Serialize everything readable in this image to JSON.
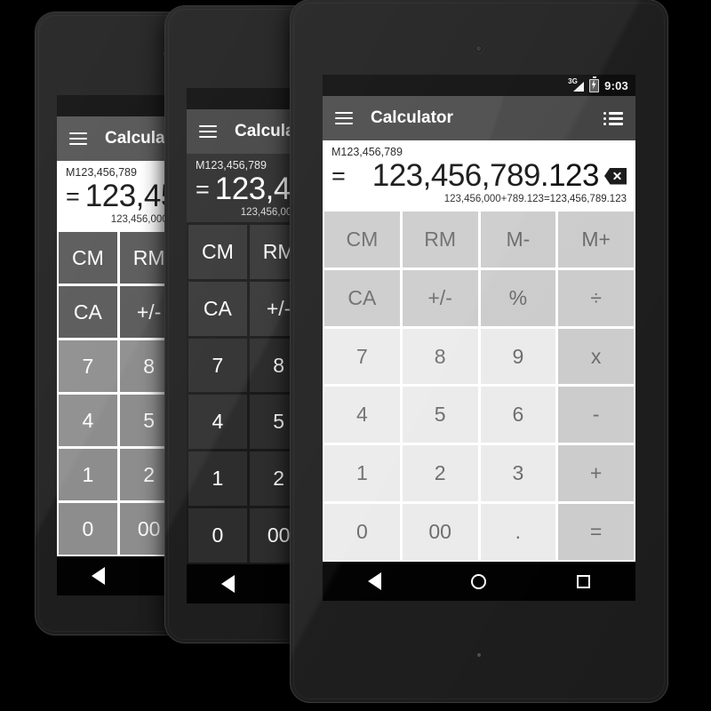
{
  "scene": {
    "background": "#000000",
    "device_count": 3,
    "description": "Three Android tablets showing a Calculator app in three color themes"
  },
  "status_bar": {
    "network_label": "3G",
    "network_icon": "signal-3g-icon",
    "battery_icon": "battery-charging-icon",
    "time": "9:03"
  },
  "app_bar": {
    "menu_icon": "hamburger-menu-icon",
    "title": "Calculator",
    "history_icon": "history-list-icon"
  },
  "display": {
    "memory_indicator": "M123,456,789",
    "equals_prefix": "=",
    "value": "123,456,789.123",
    "backspace_icon": "backspace-icon",
    "formula": "123,456,000+789.123=123,456,789.123"
  },
  "keypad": {
    "rows": [
      [
        {
          "label": "CM",
          "type": "func"
        },
        {
          "label": "RM",
          "type": "func"
        },
        {
          "label": "M-",
          "type": "func"
        },
        {
          "label": "M+",
          "type": "func"
        }
      ],
      [
        {
          "label": "CA",
          "type": "func"
        },
        {
          "label": "+/-",
          "type": "func"
        },
        {
          "label": "%",
          "type": "func"
        },
        {
          "label": "÷",
          "type": "op"
        }
      ],
      [
        {
          "label": "7",
          "type": "digit"
        },
        {
          "label": "8",
          "type": "digit"
        },
        {
          "label": "9",
          "type": "digit"
        },
        {
          "label": "x",
          "type": "op"
        }
      ],
      [
        {
          "label": "4",
          "type": "digit"
        },
        {
          "label": "5",
          "type": "digit"
        },
        {
          "label": "6",
          "type": "digit"
        },
        {
          "label": "-",
          "type": "op"
        }
      ],
      [
        {
          "label": "1",
          "type": "digit"
        },
        {
          "label": "2",
          "type": "digit"
        },
        {
          "label": "3",
          "type": "digit"
        },
        {
          "label": "+",
          "type": "op"
        }
      ],
      [
        {
          "label": "0",
          "type": "digit"
        },
        {
          "label": "00",
          "type": "digit"
        },
        {
          "label": ".",
          "type": "digit"
        },
        {
          "label": "=",
          "type": "op"
        }
      ]
    ]
  },
  "nav_bar": {
    "back_icon": "back-triangle-icon",
    "home_icon": "home-circle-icon",
    "recents_icon": "recents-square-icon"
  },
  "themes": {
    "front": {
      "name": "light",
      "app_bar_bg": "#424242",
      "display_bg": "#ffffff",
      "digit_key_bg": "#ebebeb",
      "func_key_bg": "#cccccc",
      "key_text": "#6d6d6d"
    },
    "middle": {
      "name": "dark",
      "app_bar_bg": "#3a3a3a",
      "display_bg": "#2b2b2b",
      "digit_key_bg": "#2b2b2b",
      "func_key_bg": "#333333",
      "key_text": "#ffffff"
    },
    "back": {
      "name": "gray",
      "app_bar_bg": "#4a4a4a",
      "display_bg": "#ffffff",
      "digit_key_bg": "#8c8c8c",
      "func_key_bg": "#555555",
      "key_text": "#ffffff"
    }
  }
}
